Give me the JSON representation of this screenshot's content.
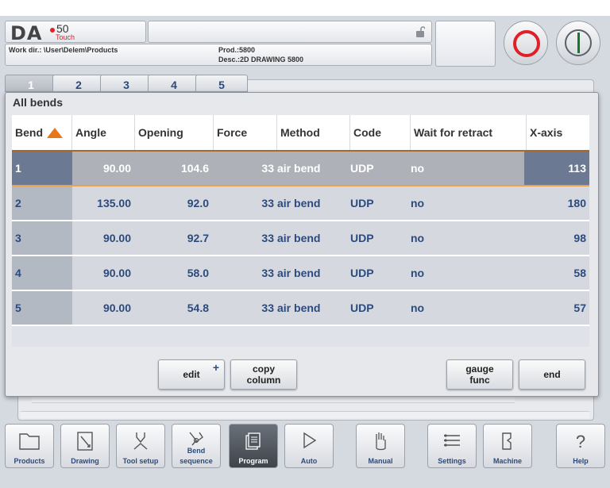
{
  "header": {
    "logo_text": "DA",
    "logo_model": "50",
    "logo_sub": "Touch",
    "work_dir": "Work dir.: \\User\\Delem\\Products",
    "product": "Prod.:5800",
    "description": "Desc.:2D DRAWING 5800"
  },
  "step_tabs": [
    "1",
    "2",
    "3",
    "4",
    "5"
  ],
  "dialog": {
    "title": "All bends",
    "columns": [
      "Bend",
      "Angle",
      "Opening",
      "Force",
      "Method",
      "Code",
      "Wait for retract",
      "X-axis"
    ],
    "rows": [
      {
        "bend": "1",
        "angle": "90.00",
        "opening": "104.6",
        "force": "33",
        "method": "air bend",
        "code": "UDP",
        "wait": "no",
        "x": "113"
      },
      {
        "bend": "2",
        "angle": "135.00",
        "opening": "92.0",
        "force": "33",
        "method": "air bend",
        "code": "UDP",
        "wait": "no",
        "x": "180"
      },
      {
        "bend": "3",
        "angle": "90.00",
        "opening": "92.7",
        "force": "33",
        "method": "air bend",
        "code": "UDP",
        "wait": "no",
        "x": "98"
      },
      {
        "bend": "4",
        "angle": "90.00",
        "opening": "58.0",
        "force": "33",
        "method": "air bend",
        "code": "UDP",
        "wait": "no",
        "x": "58"
      },
      {
        "bend": "5",
        "angle": "90.00",
        "opening": "54.8",
        "force": "33",
        "method": "air bend",
        "code": "UDP",
        "wait": "no",
        "x": "57"
      }
    ],
    "buttons": {
      "edit": "edit",
      "edit_plus": "+",
      "copy_line1": "copy",
      "copy_line2": "column",
      "gauge_line1": "gauge",
      "gauge_line2": "func",
      "end": "end"
    }
  },
  "nav": {
    "products": "Products",
    "drawing": "Drawing",
    "tool_setup": "Tool setup",
    "bend_top": "Bend",
    "bend_bottom": "sequence",
    "program": "Program",
    "auto": "Auto",
    "manual": "Manual",
    "settings": "Settings",
    "machine": "Machine",
    "help": "Help"
  },
  "colors": {
    "accent_text": "#2c4a7c",
    "sort_indicator": "#e8771a",
    "stop_ring": "#e01f26",
    "start_bar": "#0f7a30",
    "selected_row": "#6b7a92"
  }
}
